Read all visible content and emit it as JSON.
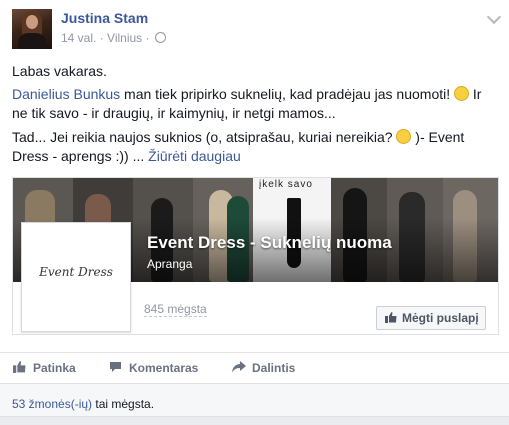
{
  "post": {
    "author": "Justina Stam",
    "time": "14 val.",
    "separator": "·",
    "location": "Vilnius",
    "privacy_icon": "globe-icon",
    "paragraph1": "Labas vakaras.",
    "paragraph2": {
      "mention": "Danielius Bunkus",
      "line1_rest": " man tiek pripirko suknelių, kad pradėjau jas nuomoti! ",
      "line1_end": " Ir",
      "line2": "ne tik savo - ir draugių, ir kaimynių, ir netgi mamos..."
    },
    "paragraph3": {
      "line1": "Tad... Jei reikia naujos suknios (o, atsiprašau, kuriai nereikia? ",
      "line1_end": " )- Event",
      "line2": "Dress - aprengs :)) ...",
      "see_more": "Žiūrėti daugiau"
    }
  },
  "shared_page": {
    "cover_text": "įkelk savo",
    "name": "Event Dress - Suknelių nuoma",
    "category": "Apranga",
    "logo_text": "Event Dress",
    "likes": "845 mėgsta",
    "like_button": "Mėgti puslapį"
  },
  "actions": {
    "like": "Patinka",
    "comment": "Komentaras",
    "share": "Dalintis"
  },
  "summary": {
    "count": "53 žmonės(-ių)",
    "rest": " tai mėgsta."
  },
  "colors": {
    "link": "#3b5998",
    "meta": "#9197a3",
    "background": "#e9ebee"
  }
}
